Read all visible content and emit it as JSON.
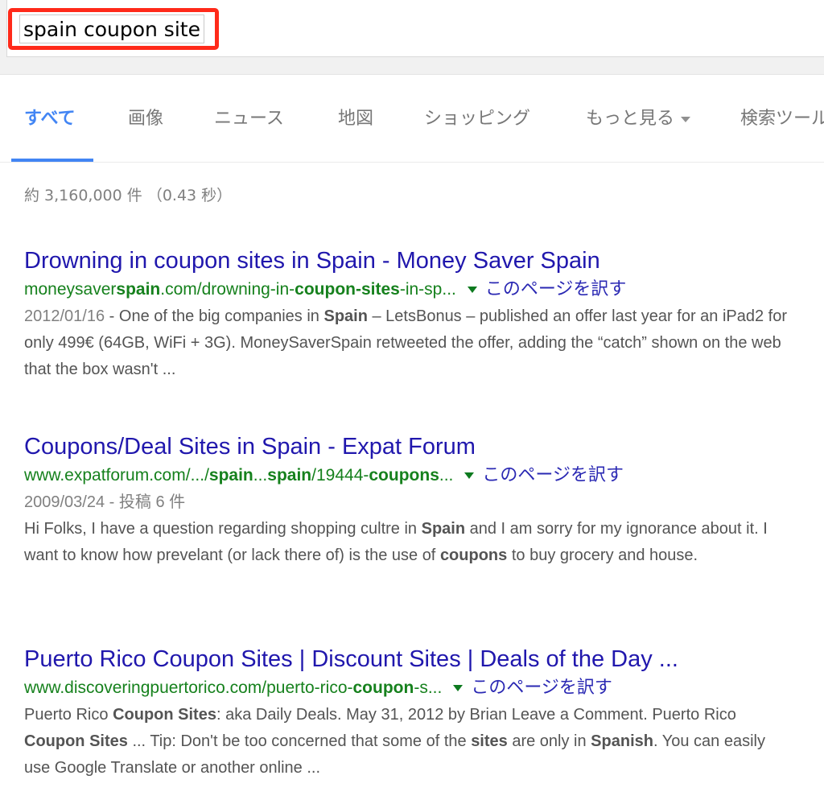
{
  "search": {
    "query": "spain coupon site"
  },
  "tabs": [
    {
      "label": "すべて",
      "active": true
    },
    {
      "label": "画像"
    },
    {
      "label": "ニュース"
    },
    {
      "label": "地図"
    },
    {
      "label": "ショッピング"
    },
    {
      "label": "もっと見る"
    },
    {
      "label": "検索ツール"
    }
  ],
  "stats": "約 3,160,000 件 （0.43 秒）",
  "translate_label": "このページを訳す",
  "results": [
    {
      "title": "Drowning in coupon sites in Spain - Money Saver Spain",
      "url_parts": [
        "moneysaver",
        "spain",
        ".com/drowning-in-",
        "coupon-sites",
        "-in-sp..."
      ],
      "date": "2012/01/16",
      "meta": "",
      "snippet_parts": [
        " - One of the big companies in ",
        "Spain",
        " – LetsBonus – published an offer last year for an iPad2 for only 499€ (64GB, WiFi + 3G). MoneySaverSpain retweeted the offer, adding the “catch” shown on the web that the box wasn't ..."
      ]
    },
    {
      "title": "Coupons/Deal Sites in Spain - Expat Forum",
      "url_parts": [
        "www.expatforum.com/.../",
        "spain",
        "...",
        "spain",
        "/19444-",
        "coupons",
        "..."
      ],
      "date": "2009/03/24",
      "meta": " - 投稿 6 件",
      "snippet_parts": [
        "Hi Folks, I have a question regarding shopping cultre in ",
        "Spain",
        " and I am sorry for my ignorance about it. I want to know how prevelant (or lack there of) is the use of ",
        "coupons",
        " to buy grocery and house."
      ]
    },
    {
      "title": "Puerto Rico Coupon Sites | Discount Sites | Deals of the Day ...",
      "url_parts": [
        "www.discoveringpuertorico.com/puerto-rico-",
        "coupon",
        "-s..."
      ],
      "date": "",
      "meta": "",
      "snippet_parts": [
        "Puerto Rico ",
        "Coupon Sites",
        ": aka Daily Deals. May 31, 2012 by Brian Leave a Comment. Puerto Rico ",
        "Coupon Sites",
        " ... Tip: Don't be too concerned that some of the ",
        "sites",
        " are only in ",
        "Spanish",
        ". You can easily use Google Translate or another online ..."
      ]
    }
  ]
}
